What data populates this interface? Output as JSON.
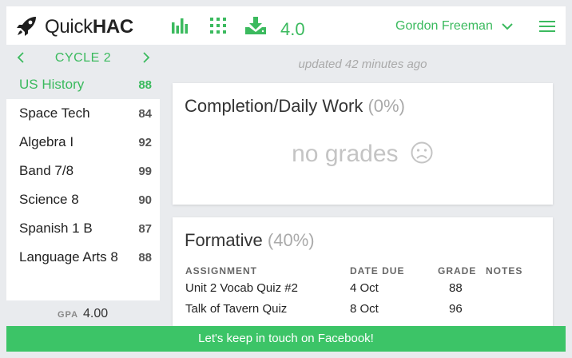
{
  "app": {
    "logo_prefix": "Quick",
    "logo_bold": "HAC",
    "version": "4.0"
  },
  "toolbar": {
    "user_name": "Gordon Freeman"
  },
  "sidebar": {
    "cycle_label": "CYCLE 2",
    "courses": [
      {
        "name": "US History",
        "grade": "88",
        "active": true
      },
      {
        "name": "Space Tech",
        "grade": "84"
      },
      {
        "name": "Algebra I",
        "grade": "92"
      },
      {
        "name": "Band 7/8",
        "grade": "99"
      },
      {
        "name": "Science 8",
        "grade": "90"
      },
      {
        "name": "Spanish 1 B",
        "grade": "87"
      },
      {
        "name": "Language Arts 8",
        "grade": "88"
      }
    ],
    "gpa_label": "GPA",
    "gpa_value": "4.00"
  },
  "main": {
    "updated": "updated 42 minutes ago",
    "categories": [
      {
        "title": "Completion/Daily Work",
        "weight": "(0%)",
        "empty_text": "no grades"
      },
      {
        "title": "Formative",
        "weight": "(40%)",
        "headers": {
          "assignment": "ASSIGNMENT",
          "date_due": "DATE DUE",
          "grade": "GRADE",
          "notes": "NOTES"
        },
        "rows": [
          {
            "name": "Unit 2 Vocab Quiz #2",
            "date": "4 Oct",
            "grade": "88"
          },
          {
            "name": "Talk of Tavern Quiz",
            "date": "8 Oct",
            "grade": "96"
          }
        ]
      }
    ]
  },
  "banner": {
    "text": "Let's keep in touch on Facebook!"
  },
  "colors": {
    "accent": "#3bba5e",
    "banner": "#3cc467",
    "background": "#e9ebee"
  }
}
